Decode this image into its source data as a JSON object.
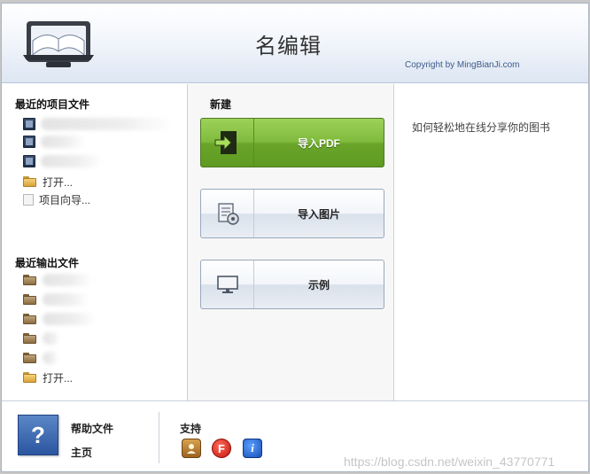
{
  "header": {
    "title": "名编辑",
    "copyright": "Copyright by MingBianJi.com"
  },
  "left": {
    "recent_projects_title": "最近的项目文件",
    "recent_projects": [
      {
        "icon": "book-icon"
      },
      {
        "icon": "book-icon"
      },
      {
        "icon": "book-icon"
      }
    ],
    "open_label": "打开...",
    "wizard_label": "项目向导...",
    "recent_outputs_title": "最近输出文件",
    "recent_outputs": [
      {
        "icon": "folder-icon"
      },
      {
        "icon": "folder-icon"
      },
      {
        "icon": "folder-icon"
      },
      {
        "icon": "folder-icon"
      },
      {
        "icon": "folder-icon"
      }
    ],
    "open_output_label": "打开..."
  },
  "middle": {
    "new_title": "新建",
    "import_pdf_label": "导入PDF",
    "import_images_label": "导入图片",
    "examples_label": "示例"
  },
  "right": {
    "tip_link": "如何轻松地在线分享你的图书"
  },
  "footer": {
    "help_label": "帮助文件",
    "home_label": "主页",
    "support_label": "支持",
    "watermark": "https://blog.csdn.net/weixin_43770771"
  },
  "colors": {
    "accent_green": "#7fbb3c",
    "header_blue": "#dde6f3",
    "link_blue": "#3d5a8a"
  }
}
